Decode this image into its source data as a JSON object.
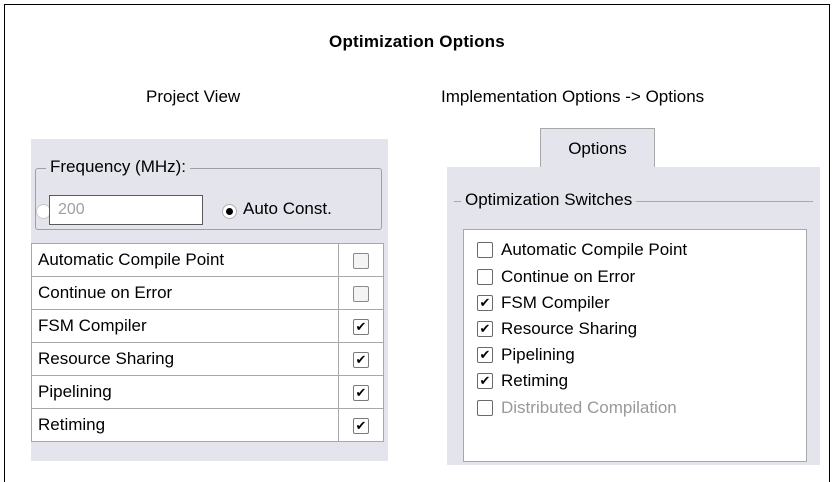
{
  "title": "Optimization Options",
  "project_view": {
    "heading": "Project View",
    "frequency": {
      "label": "Frequency (MHz):",
      "value": "200",
      "auto_label": "Auto Const.",
      "selected": "auto"
    },
    "options": [
      {
        "label": "Automatic Compile Point",
        "checked": false
      },
      {
        "label": "Continue on Error",
        "checked": false
      },
      {
        "label": "FSM Compiler",
        "checked": true
      },
      {
        "label": "Resource Sharing",
        "checked": true
      },
      {
        "label": "Pipelining",
        "checked": true
      },
      {
        "label": "Retiming",
        "checked": true
      }
    ]
  },
  "implementation": {
    "heading": "Implementation Options -> Options",
    "tab_label": "Options",
    "group_label": "Optimization Switches",
    "switches": [
      {
        "label": "Automatic Compile Point",
        "checked": false,
        "enabled": true
      },
      {
        "label": "Continue on Error",
        "checked": false,
        "enabled": true
      },
      {
        "label": "FSM Compiler",
        "checked": true,
        "enabled": true
      },
      {
        "label": "Resource Sharing",
        "checked": true,
        "enabled": true
      },
      {
        "label": "Pipelining",
        "checked": true,
        "enabled": true
      },
      {
        "label": "Retiming",
        "checked": true,
        "enabled": true
      },
      {
        "label": "Distributed Compilation",
        "checked": false,
        "enabled": false
      }
    ]
  },
  "check_glyph": "✔"
}
